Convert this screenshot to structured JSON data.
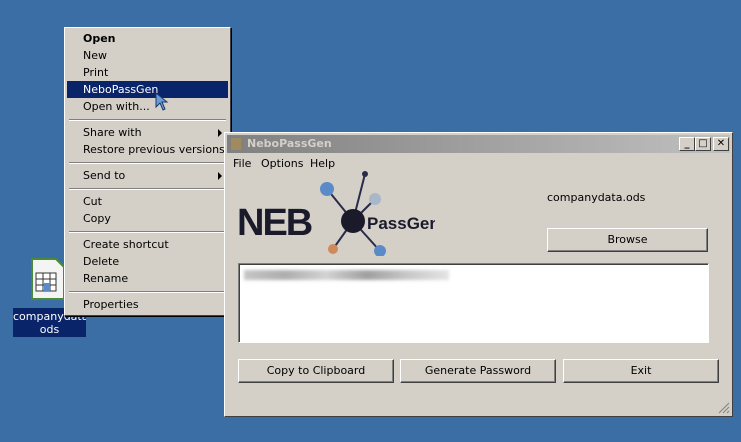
{
  "desktop": {
    "file_icon_label": "companydata.\nods"
  },
  "context_menu": {
    "items": [
      {
        "label": "Open",
        "bold": true
      },
      {
        "label": "New"
      },
      {
        "label": "Print"
      },
      {
        "label": "NeboPassGen",
        "highlighted": true
      },
      {
        "label": "Open with..."
      },
      {
        "label": "Share with",
        "submenu": true
      },
      {
        "label": "Restore previous versions"
      },
      {
        "label": "Send to",
        "submenu": true
      },
      {
        "label": "Cut"
      },
      {
        "label": "Copy"
      },
      {
        "label": "Create shortcut"
      },
      {
        "label": "Delete"
      },
      {
        "label": "Rename"
      },
      {
        "label": "Properties"
      }
    ]
  },
  "window": {
    "title": "NeboPassGen",
    "menu": [
      "File",
      "Options",
      "Help"
    ],
    "logo": {
      "main": "NEB",
      "sub": "PassGen"
    },
    "filename": "companydata.ods",
    "browse_label": "Browse",
    "copy_label": "Copy to Clipboard",
    "generate_label": "Generate Password",
    "exit_label": "Exit"
  },
  "colors": {
    "desktop": "#3a6ea5",
    "selection": "#0a246a",
    "face": "#d4d0c8"
  }
}
